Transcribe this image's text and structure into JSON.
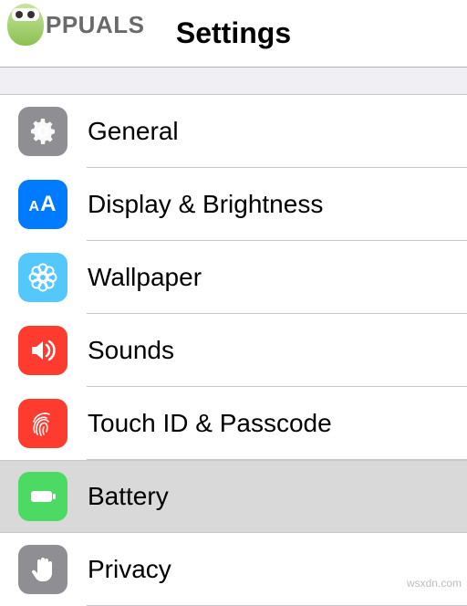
{
  "header": {
    "logo_text": "PPUALS",
    "title": "Settings"
  },
  "items": [
    {
      "id": "general",
      "label": "General",
      "icon": "gear-icon",
      "bg": "bg-gray",
      "selected": false
    },
    {
      "id": "display",
      "label": "Display & Brightness",
      "icon": "text-size-icon",
      "bg": "bg-blue",
      "selected": false
    },
    {
      "id": "wallpaper",
      "label": "Wallpaper",
      "icon": "flower-icon",
      "bg": "bg-cyan",
      "selected": false
    },
    {
      "id": "sounds",
      "label": "Sounds",
      "icon": "speaker-icon",
      "bg": "bg-red",
      "selected": false
    },
    {
      "id": "touchid",
      "label": "Touch ID & Passcode",
      "icon": "fingerprint-icon",
      "bg": "bg-red",
      "selected": false
    },
    {
      "id": "battery",
      "label": "Battery",
      "icon": "battery-icon",
      "bg": "bg-green",
      "selected": true
    },
    {
      "id": "privacy",
      "label": "Privacy",
      "icon": "hand-icon",
      "bg": "bg-gray",
      "selected": false
    }
  ],
  "watermark": "wsxdn.com"
}
